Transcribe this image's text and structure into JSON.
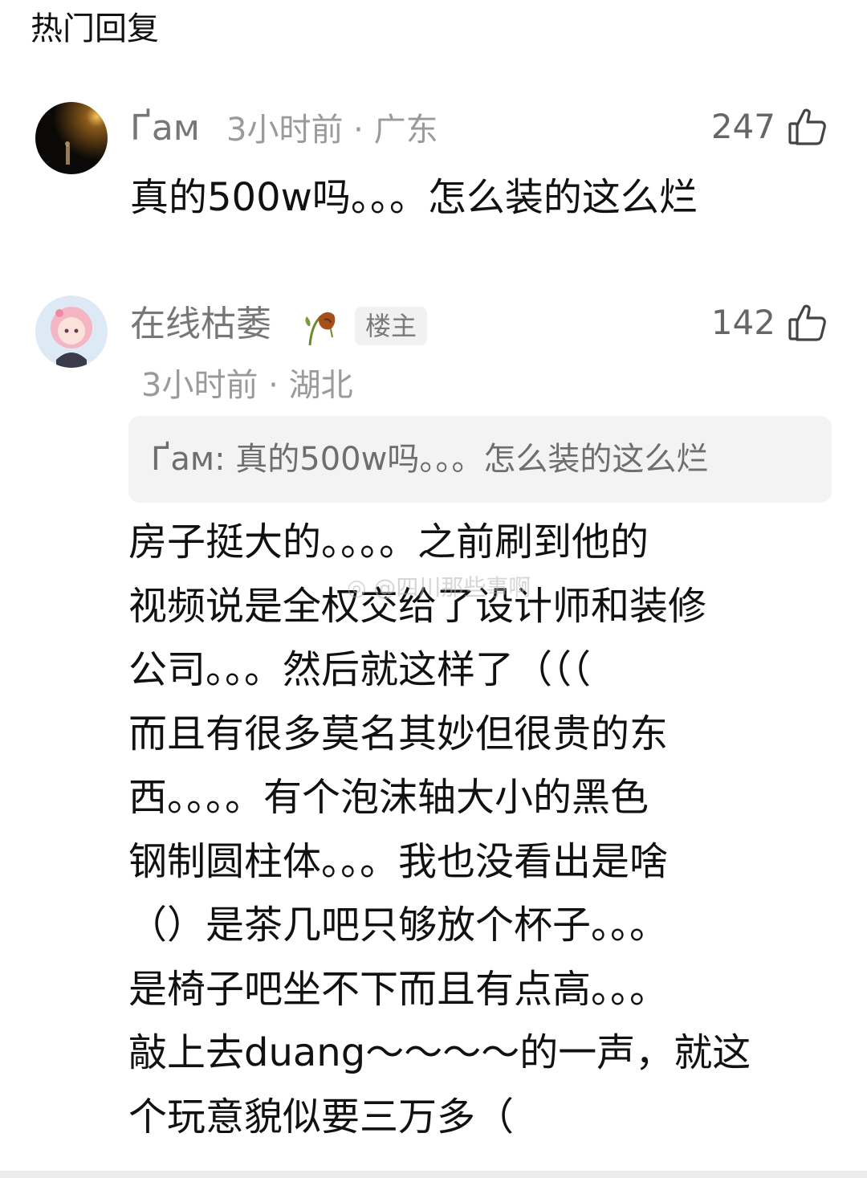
{
  "section": {
    "title": "热门回复"
  },
  "comments": [
    {
      "username": "Ґам",
      "meta": "3小时前 · 广东",
      "likes": "247",
      "text": "真的500w吗。。。怎么装的这么烂"
    },
    {
      "username": "在线枯萎",
      "badge": "楼主",
      "meta": "3小时前 · 湖北",
      "likes": "142",
      "quote": "Ґам: 真的500w吗。。。怎么装的这么烂",
      "lines": [
        "房子挺大的。。。。之前刷到他的",
        "视频说是全权交给了设计师和装修",
        "公司。。。然后就这样了（（（",
        "而且有很多莫名其妙但很贵的东",
        "西。。。。有个泡沫轴大小的黑色",
        "钢制圆柱体。。。我也没看出是啥",
        "（）是茶几吧只够放个杯子。。。",
        "是椅子吧坐不下而且有点高。。。",
        "敲上去duang～～～～的一声，就这",
        "个玩意貌似要三万多（"
      ]
    }
  ],
  "watermark": "@四川那些事啊",
  "icons": {
    "like": "thumbs-up-icon",
    "emoji": "wilted-flower-icon",
    "weibo": "weibo-logo-icon"
  },
  "colors": {
    "text_primary": "#111111",
    "text_secondary": "#777777",
    "meta": "#9a9a9a",
    "quote_bg": "#f3f3f3",
    "badge_bg": "#f1f1f1"
  }
}
